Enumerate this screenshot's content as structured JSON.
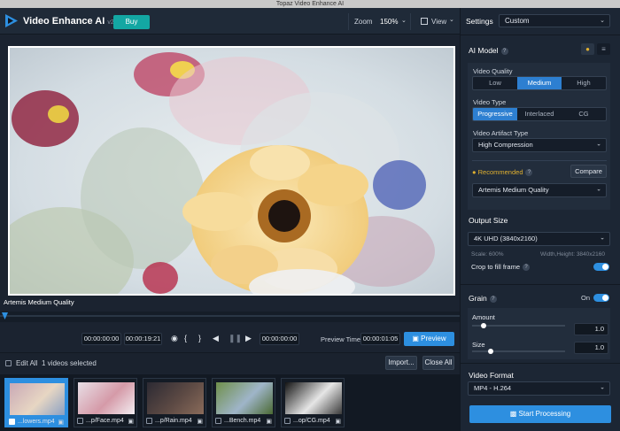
{
  "window_title": "Topaz Video Enhance AI",
  "app": {
    "name": "Video Enhance AI",
    "version": "v2.6.4",
    "buy_label": "Buy"
  },
  "toolbar": {
    "zoom_label": "Zoom",
    "zoom_value": "150%",
    "view_label": "View"
  },
  "settings": {
    "label": "Settings",
    "preset": "Custom",
    "ai_model": {
      "title": "AI Model",
      "video_quality_label": "Video Quality",
      "quality_options": [
        "Low",
        "Medium",
        "High"
      ],
      "quality_selected": "Medium",
      "video_type_label": "Video Type",
      "type_options": [
        "Progressive",
        "Interlaced",
        "CG"
      ],
      "type_selected": "Progressive",
      "artifact_label": "Video Artifact Type",
      "artifact_value": "High Compression",
      "recommended_label": "Recommended",
      "compare_label": "Compare",
      "model_value": "Artemis Medium Quality"
    },
    "output_size": {
      "title": "Output Size",
      "value": "4K UHD (3840x2160)",
      "scale": "Scale: 600%",
      "dimensions": "Width,Height: 3840x2160",
      "crop_label": "Crop to fill frame",
      "crop_on": true
    },
    "grain": {
      "title": "Grain",
      "state": "On",
      "amount_label": "Amount",
      "amount_value": "1.0",
      "amount_fraction": 0.12,
      "size_label": "Size",
      "size_value": "1.0",
      "size_fraction": 0.2
    },
    "video_format": {
      "title": "Video Format",
      "value": "MP4 - H.264"
    },
    "start_label": "Start Processing"
  },
  "preview": {
    "caption": "Artemis Medium Quality",
    "time_start": "00:00:00:00",
    "time_end": "00:00:19:21",
    "time_current": "00:00:00:00",
    "preview_time_label": "Preview Time",
    "preview_time_value": "00:00:01:05",
    "preview_label": "Preview",
    "playhead_fraction": 0.0
  },
  "file_bar": {
    "edit_all": "Edit All",
    "selected_count": "1 videos selected",
    "import_label": "Import...",
    "close_all_label": "Close All"
  },
  "files": [
    {
      "name": "...lowers.mp4",
      "selected": true,
      "colors": [
        "#c9a9b6",
        "#e7d6c3",
        "#8aa0c3"
      ]
    },
    {
      "name": "...p/Face.mp4",
      "selected": false,
      "colors": [
        "#e8dfe6",
        "#d59aa8",
        "#f3eef2"
      ]
    },
    {
      "name": "...p/Rain.mp4",
      "selected": false,
      "colors": [
        "#2c2a33",
        "#5d4a44",
        "#8a6b5a"
      ]
    },
    {
      "name": "...Bench.mp4",
      "selected": false,
      "colors": [
        "#6f8f4a",
        "#9fb5c9",
        "#4b6a33"
      ]
    },
    {
      "name": "...op/CG.mp4",
      "selected": false,
      "colors": [
        "#141414",
        "#e6e6e6",
        "#3a3a3a"
      ]
    }
  ],
  "colors": {
    "accent": "#2d8fe0",
    "teal": "#13a7a3",
    "recommended": "#e0b030"
  }
}
